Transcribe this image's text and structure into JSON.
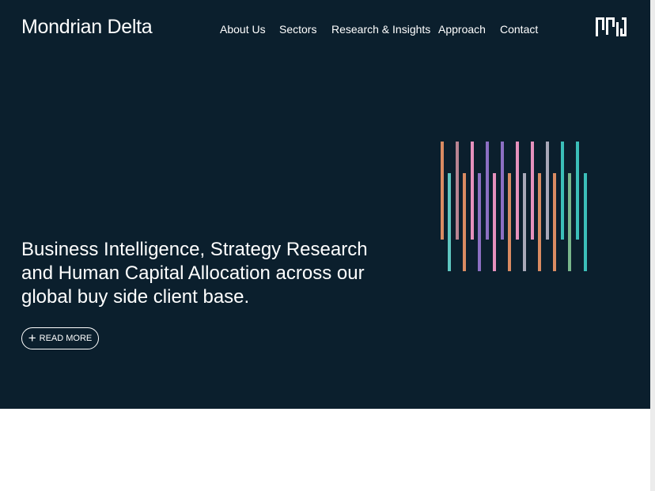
{
  "brand": {
    "name": "Mondrian Delta"
  },
  "nav": {
    "items": [
      {
        "label": "About Us"
      },
      {
        "label": "Sectors"
      },
      {
        "label": "Research & Insights"
      },
      {
        "label": "Approach"
      },
      {
        "label": "Contact"
      }
    ]
  },
  "hero": {
    "headline": "Business Intelligence, Strategy Research and Human Capital Allocation across our global buy side client base.",
    "cta_label": "READ MORE",
    "cta_icon": "plus-icon",
    "background_color": "#0b1f2d",
    "bar_palette": [
      "#d98b62",
      "#5fc6c0",
      "#b98492",
      "#e691bd",
      "#8c6fc3",
      "#a8a8b8",
      "#3bbfb9",
      "#79b68c"
    ]
  },
  "logo": {
    "icon": "mondrian-delta-mark-icon"
  }
}
